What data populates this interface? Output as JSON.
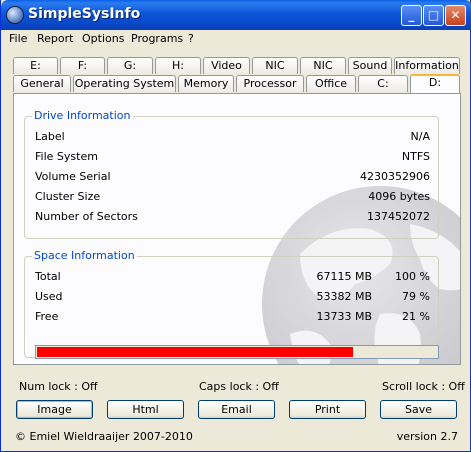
{
  "window": {
    "title": "SimpleSysInfo"
  },
  "titlebar_buttons": {
    "minimize": "_",
    "maximize": "□",
    "close": "✕"
  },
  "menu": [
    "File",
    "Report",
    "Options",
    "Programs",
    "?"
  ],
  "tabs_row1": [
    "E:",
    "F:",
    "G:",
    "H:",
    "Video",
    "NIC",
    "NIC",
    "Sound",
    "Information"
  ],
  "tabs_row2": [
    "General",
    "Operating System",
    "Memory",
    "Processor",
    "Office",
    "C:",
    "D:"
  ],
  "active_tab": "D:",
  "drive_info": {
    "title": "Drive Information",
    "rows": [
      {
        "label": "Label",
        "value": "N/A"
      },
      {
        "label": "File System",
        "value": "NTFS"
      },
      {
        "label": "Volume Serial",
        "value": "4230352906"
      },
      {
        "label": "Cluster Size",
        "value": "4096 bytes"
      },
      {
        "label": "Number of Sectors",
        "value": "137452072"
      }
    ]
  },
  "space_info": {
    "title": "Space Information",
    "rows": [
      {
        "label": "Total",
        "mb": "67115 MB",
        "pct": "100 %"
      },
      {
        "label": "Used",
        "mb": "53382 MB",
        "pct": "79 %"
      },
      {
        "label": "Free",
        "mb": "13733 MB",
        "pct": "21 %"
      }
    ],
    "used_fraction": 0.79,
    "bar_color": "#ff0000"
  },
  "status": {
    "num_lock": "Num lock : Off",
    "caps_lock": "Caps lock : Off",
    "scroll_lock": "Scroll lock : Off"
  },
  "buttons": [
    "Image",
    "Html",
    "Email",
    "Print",
    "Save"
  ],
  "footer": {
    "copyright": "© Emiel Wieldraaijer 2007-2010",
    "version": "version 2.7"
  },
  "icons": {
    "app": "globe-icon",
    "background": "globe-watermark"
  }
}
